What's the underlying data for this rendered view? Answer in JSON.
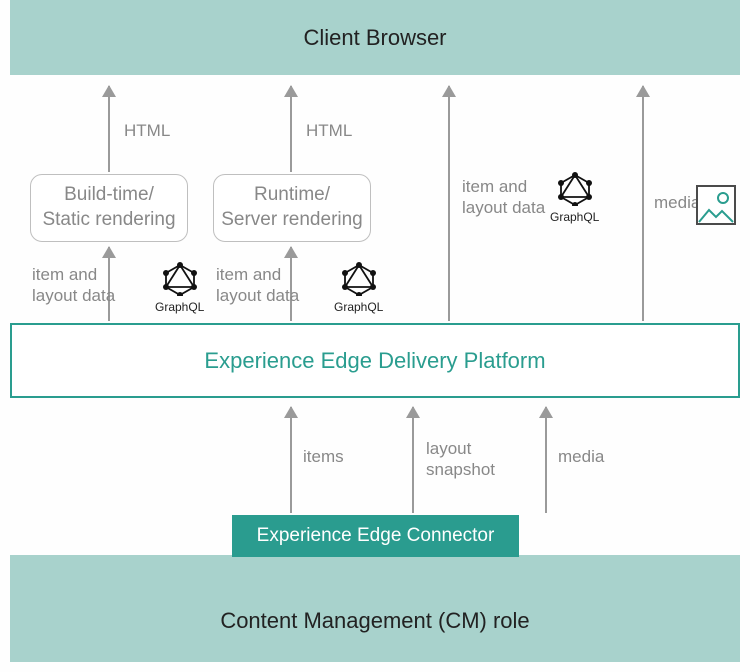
{
  "client": "Client Browser",
  "nodes": {
    "build": "Build-time/\nStatic rendering",
    "runtime": "Runtime/\nServer rendering"
  },
  "platform": "Experience Edge Delivery Platform",
  "connector": "Experience Edge Connector",
  "cm": "Content Management (CM) role",
  "labels": {
    "html1": "HTML",
    "html2": "HTML",
    "itemLayout1": "item and\nlayout data",
    "itemLayout2": "item and\nlayout data",
    "itemLayout3": "item and\nlayout data",
    "media1": "media",
    "items": "items",
    "layoutSnap": "layout\nsnapshot",
    "media2": "media",
    "graphql": "GraphQL"
  }
}
